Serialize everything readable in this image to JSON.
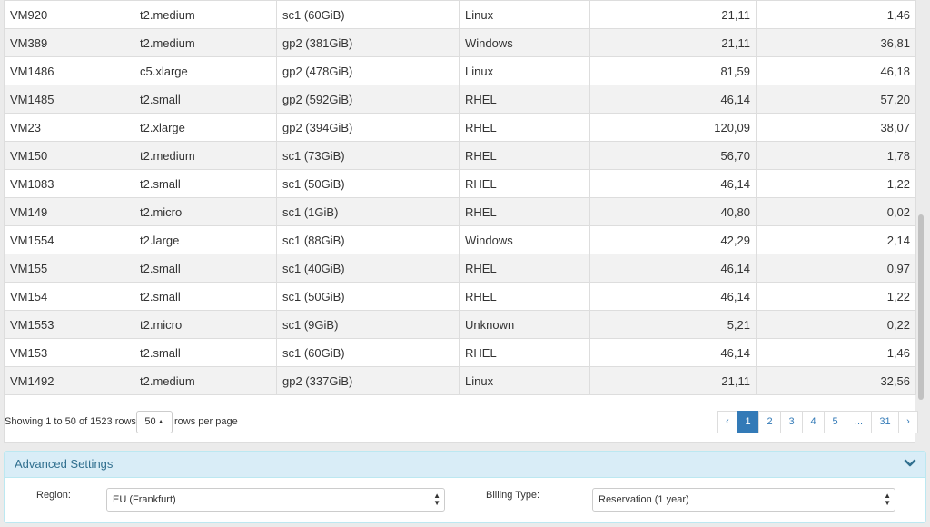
{
  "table": {
    "rows": [
      [
        "VM920",
        "t2.medium",
        "sc1 (60GiB)",
        "Linux",
        "21,11",
        "1,46"
      ],
      [
        "VM389",
        "t2.medium",
        "gp2 (381GiB)",
        "Windows",
        "21,11",
        "36,81"
      ],
      [
        "VM1486",
        "c5.xlarge",
        "gp2 (478GiB)",
        "Linux",
        "81,59",
        "46,18"
      ],
      [
        "VM1485",
        "t2.small",
        "gp2 (592GiB)",
        "RHEL",
        "46,14",
        "57,20"
      ],
      [
        "VM23",
        "t2.xlarge",
        "gp2 (394GiB)",
        "RHEL",
        "120,09",
        "38,07"
      ],
      [
        "VM150",
        "t2.medium",
        "sc1 (73GiB)",
        "RHEL",
        "56,70",
        "1,78"
      ],
      [
        "VM1083",
        "t2.small",
        "sc1 (50GiB)",
        "RHEL",
        "46,14",
        "1,22"
      ],
      [
        "VM149",
        "t2.micro",
        "sc1 (1GiB)",
        "RHEL",
        "40,80",
        "0,02"
      ],
      [
        "VM1554",
        "t2.large",
        "sc1 (88GiB)",
        "Windows",
        "42,29",
        "2,14"
      ],
      [
        "VM155",
        "t2.small",
        "sc1 (40GiB)",
        "RHEL",
        "46,14",
        "0,97"
      ],
      [
        "VM154",
        "t2.small",
        "sc1 (50GiB)",
        "RHEL",
        "46,14",
        "1,22"
      ],
      [
        "VM1553",
        "t2.micro",
        "sc1 (9GiB)",
        "Unknown",
        "5,21",
        "0,22"
      ],
      [
        "VM153",
        "t2.small",
        "sc1 (60GiB)",
        "RHEL",
        "46,14",
        "1,46"
      ],
      [
        "VM1492",
        "t2.medium",
        "gp2 (337GiB)",
        "Linux",
        "21,11",
        "32,56"
      ]
    ]
  },
  "footer": {
    "showing_text": "Showing 1 to 50 of 1523 rows",
    "page_size": "50",
    "rows_per_page_text": "rows per page"
  },
  "pagination": {
    "pages": [
      "‹",
      "1",
      "2",
      "3",
      "4",
      "5",
      "...",
      "31",
      "›"
    ],
    "active": "1"
  },
  "advanced": {
    "title": "Advanced Settings",
    "region_label": "Region:",
    "region_value": "EU (Frankfurt)",
    "billing_label": "Billing Type:",
    "billing_value": "Reservation (1 year)"
  },
  "colors": {
    "accent": "#337ab7",
    "panel_header_bg": "#d9edf7",
    "panel_header_text": "#31708f"
  },
  "icons": {
    "panel_toggle": "chevron-down-icon",
    "page_size_caret": "caret-up-icon",
    "select_arrows": "select-arrows-icon"
  }
}
